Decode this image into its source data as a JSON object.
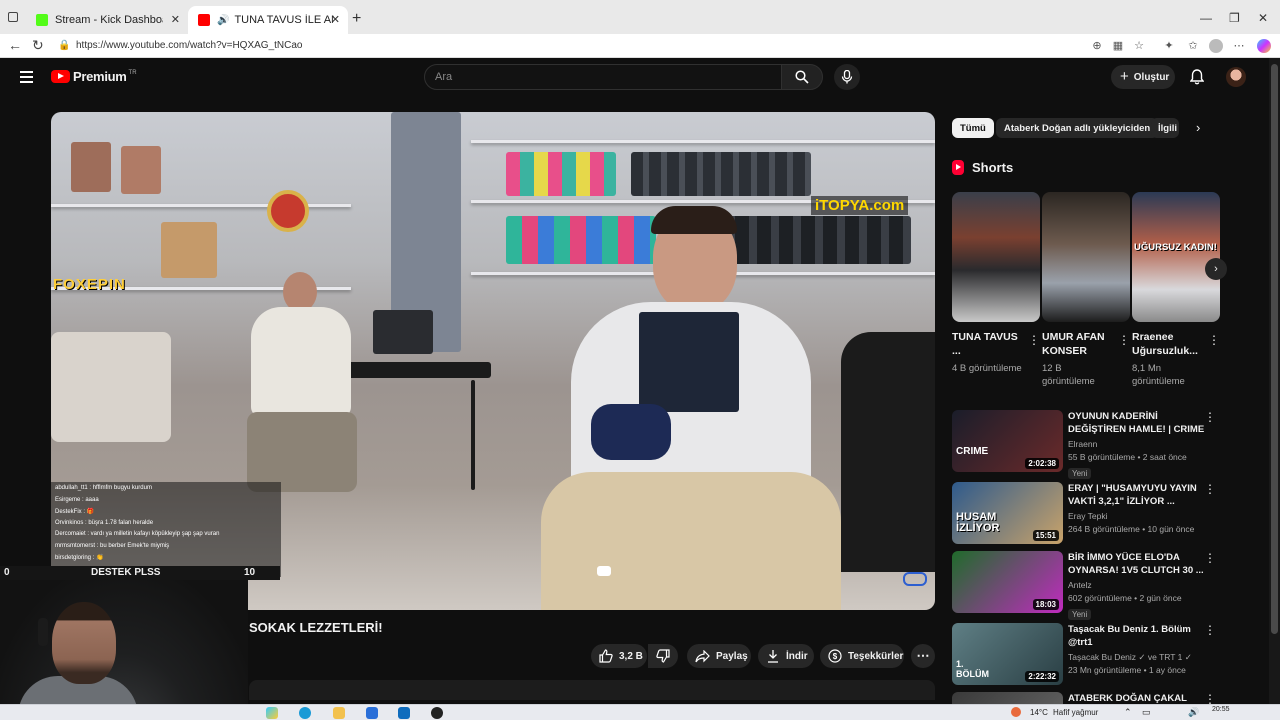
{
  "browser": {
    "tabs": [
      {
        "title": "Stream - Kick Dashboard",
        "favicon_color": "#53fc18"
      },
      {
        "title": "TUNA TAVUS İLE ANKARA G",
        "favicon_color": "#ff0000",
        "active": true
      }
    ],
    "url": "https://www.youtube.com/watch?v=HQXAG_tNCao"
  },
  "header": {
    "logo_text": "Premium",
    "logo_region": "TR",
    "search_placeholder": "Ara",
    "create_label": "Oluştur"
  },
  "video": {
    "watermark_left": "FOXEPIN",
    "watermark_right": "iTOPYA.com",
    "chat_lines": [
      "abdullah_tt1 : hfflmfm bugyu kurdum",
      "Esirgeme : aaaa",
      "DestekFix : 🎁",
      "Orvinkinos : büşra 1.78 falan heralde",
      "Dercomaiet : vardı ya milletin kafayı köpükleyip şap şap vuran",
      "mrmsmtomerst : bu berber Emek'te miymiş",
      "birsdetgloring : 👏"
    ],
    "overlay_left_num": "0",
    "overlay_label": "DESTEK PLSS",
    "overlay_right_num": "10",
    "title": "SOKAK LEZZETLERİ!",
    "likes": "3,2 B",
    "share": "Paylaş",
    "download": "İndir",
    "thanks": "Teşekkürler"
  },
  "chips": [
    "Tümü",
    "Ataberk Doğan adlı yükleyiciden",
    "İlgili"
  ],
  "shorts": {
    "heading": "Shorts",
    "items": [
      {
        "title": "TUNA TAVUS ...",
        "views": "4 B görüntüleme",
        "overlay": ""
      },
      {
        "title": "UMUR AFAN KONSER",
        "views": "12 B görüntüleme",
        "overlay": ""
      },
      {
        "title": "Rraenee Uğursuzluk...",
        "views": "8,1 Mn görüntüleme",
        "overlay": "UĞURSUZ KADIN!"
      }
    ]
  },
  "related": [
    {
      "title": "OYUNUN KADERİNİ DEĞİŞTİREN HAMLE! | CRIME ...",
      "channel": "Elraenn",
      "meta": "55 B görüntüleme • 2 saat önce",
      "badge": "Yeni",
      "duration": "2:02:38",
      "thumb_text": "CRIME",
      "colors": [
        "#1a1d2a",
        "#6b2a2a"
      ]
    },
    {
      "title": "ERAY | \"HUSAMYUYU YAYIN VAKTİ 3,2,1\" İZLİYOR ...",
      "channel": "Eray Tepki",
      "meta": "264 B görüntüleme • 10 gün önce",
      "badge": "",
      "duration": "15:51",
      "thumb_text": "HUSAM İZLİYOR",
      "colors": [
        "#2e5a8c",
        "#c9a36a"
      ]
    },
    {
      "title": "BİR İMMO YÜCE ELO'DA OYNARSA! 1V5 CLUTCH 30 ...",
      "channel": "Antelz",
      "meta": "602 görüntüleme • 2 gün önce",
      "badge": "Yeni",
      "duration": "18:03",
      "thumb_text": "",
      "colors": [
        "#1f6b2a",
        "#c02bbf"
      ]
    },
    {
      "title": "Taşacak Bu Deniz 1. Bölüm @trt1",
      "channel": "Taşacak Bu Deniz ✓ ve TRT 1 ✓",
      "meta": "23 Mn görüntüleme • 1 ay önce",
      "badge": "",
      "duration": "2:22:32",
      "thumb_text": "1. BÖLÜM",
      "colors": [
        "#5f7f85",
        "#2a3f44"
      ]
    },
    {
      "title": "ATABERK DOĞAN ÇAKAL",
      "channel": "",
      "meta": "",
      "badge": "",
      "duration": "",
      "thumb_text": "",
      "colors": [
        "#3a3a3a",
        "#6a6a6a"
      ]
    }
  ],
  "taskbar": {
    "weather": "14°C",
    "weather_desc": "Hafif yağmur",
    "time": "20:55"
  }
}
